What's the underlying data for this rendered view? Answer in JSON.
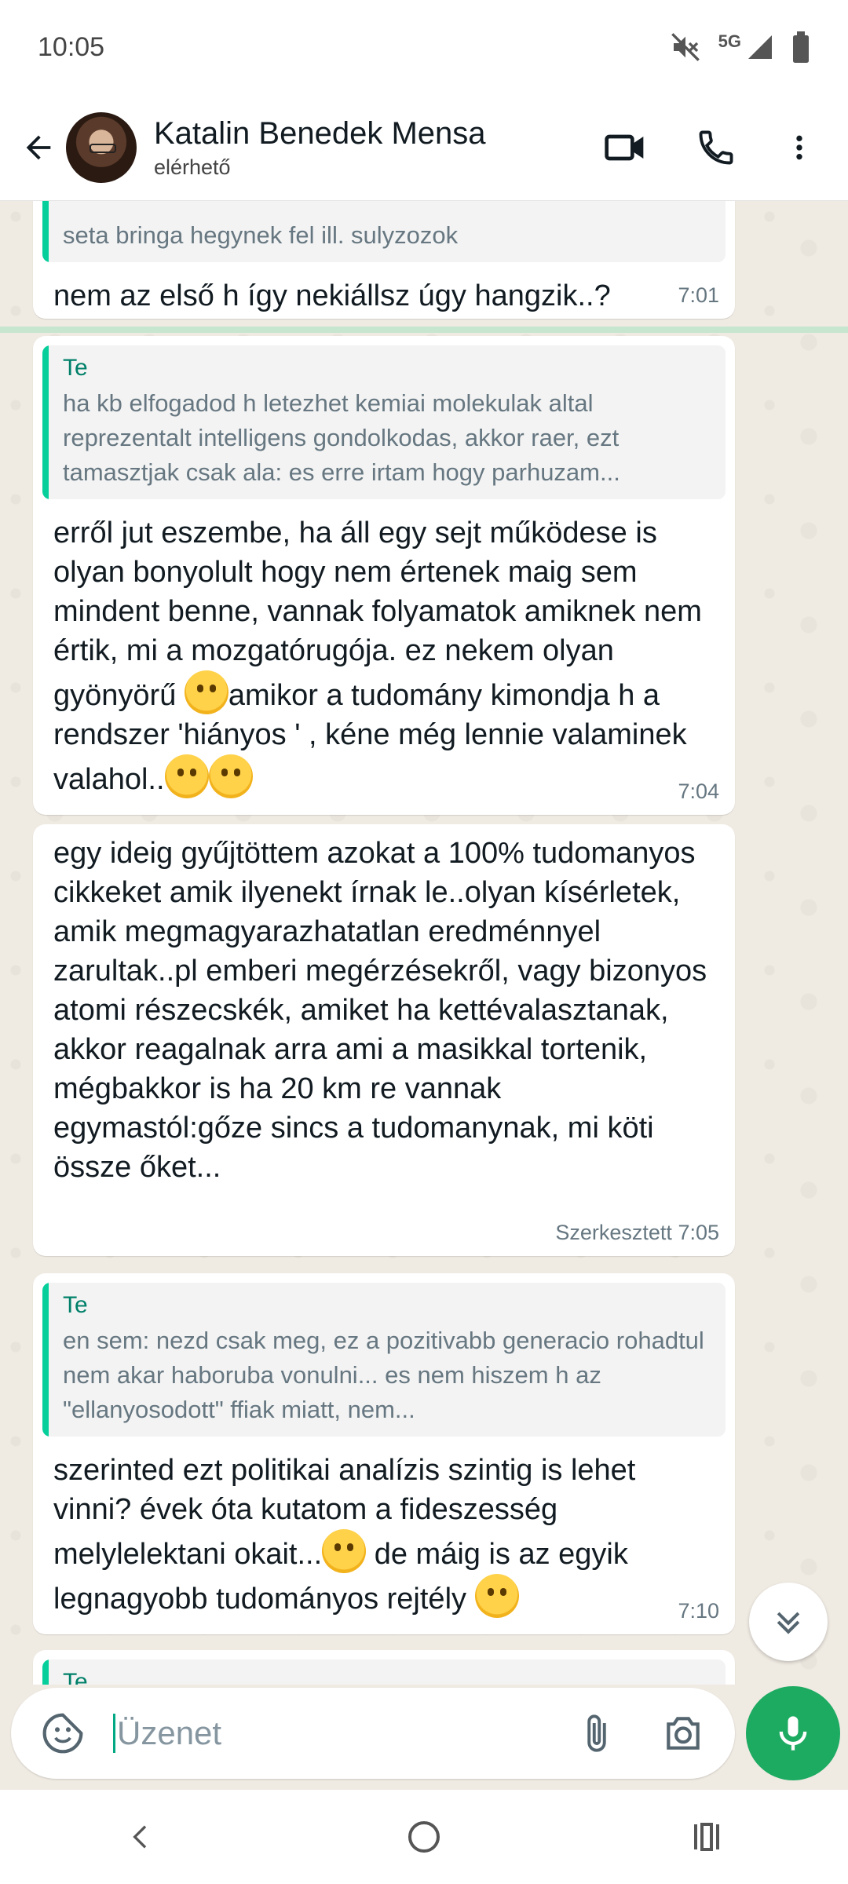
{
  "status_bar": {
    "time": "10:05",
    "network": "5G"
  },
  "header": {
    "contact_name": "Katalin Benedek Mensa",
    "contact_status": "elérhető"
  },
  "messages": [
    {
      "quote_text": "seta bringa hegynek fel ill. sulyzozok",
      "text": "nem az első h így nekiállsz úgy hangzik..?",
      "time": "7:01"
    },
    {
      "quote_author": "Te",
      "quote_text": "ha kb elfogadod h letezhet kemiai molekulak altal reprezentalt intelligens gondolkodas, akkor raer, ezt tamasztjak csak ala: es erre irtam hogy parhuzam...",
      "text_parts": [
        "erről jut eszembe, ha áll egy sejt működese is olyan bonyolult hogy nem értenek maig sem mindent benne, vannak folyamatok amiknek nem értik,  mi a mozgatórugója. ez nekem olyan gyönyörű ",
        "amikor a tudomány kimondja h a rendszer 'hiányos ' , kéne még lennie valaminek valahol.."
      ],
      "time": "7:04"
    },
    {
      "text": "egy ideig gyűjtöttem azokat a 100% tudomanyos cikkeket amik ilyenekt írnak le..olyan kísérletek,  amik megmagyarazhatatlan eredménnyel zarultak..pl emberi megérzésekről, vagy bizonyos atomi részecskék, amiket ha kettévalasztanak, akkor reagalnak arra ami a masikkal tortenik, mégbakkor is ha 20 km re vannak egymastól:gőze sincs a tudomanynak, mi köti össze őket...",
      "edited": "Szerkesztett",
      "time": "7:05"
    },
    {
      "quote_author": "Te",
      "quote_text": "en sem: nezd csak meg, ez a pozitivabb generacio rohadtul nem akar haboruba vonulni... es nem hiszem h az \"ellanyosodott\" ffiak miatt, nem...",
      "text_parts": [
        "szerinted ezt politikai analízis szintig is lehet vinni? évek óta kutatom a fideszesség melylelektani okait...",
        " de máig is az egyik legnagyobb tudományos rejtély "
      ],
      "time": "7:10"
    },
    {
      "quote_author": "Te"
    }
  ],
  "composer": {
    "placeholder": "Üzenet"
  },
  "colors": {
    "accent": "#00a884",
    "mic_button": "#1daa61",
    "quote_bar": "#06cf9c",
    "chat_bg": "#efeae2"
  }
}
